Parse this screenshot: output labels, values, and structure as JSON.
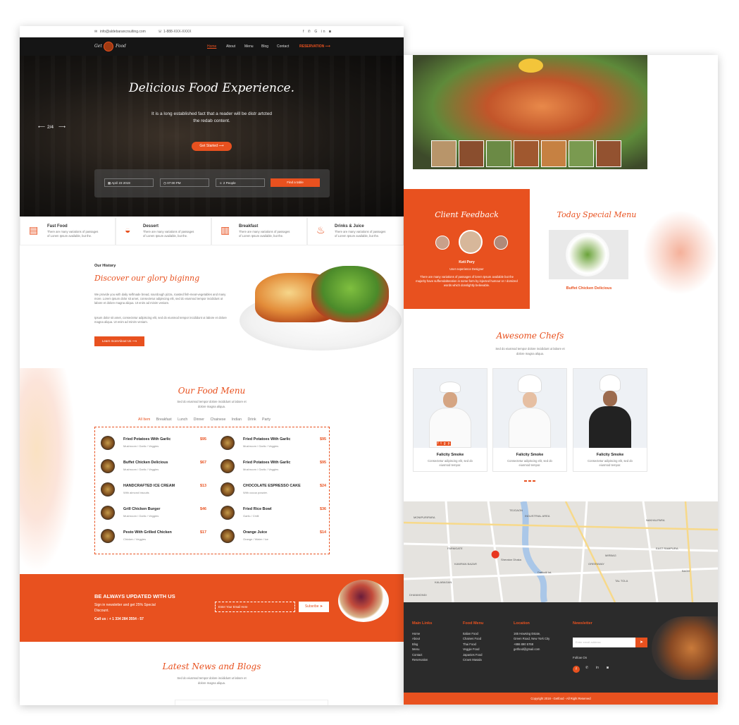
{
  "top": {
    "email": "info@aldebarancrsulting.com",
    "phone": "1-888-XXX-XXXX",
    "social_icons": [
      "facebook-icon",
      "twitter-icon",
      "google-icon",
      "linkedin-icon",
      "instagram-icon"
    ]
  },
  "brand": {
    "logo_left": "Get",
    "logo_right": "Food"
  },
  "nav": {
    "items": [
      "Home",
      "About",
      "Menu",
      "Blog",
      "Contact"
    ],
    "reservation": "RESERVATION",
    "active": "Home"
  },
  "hero": {
    "title": "Delicious Food Experience.",
    "subtitle_line1": "It is a long established fact that a reader will be distr artcted",
    "subtitle_line2": "the redab content.",
    "slide": "2/4",
    "cta": "Get Started"
  },
  "booking": {
    "date": "April 23 2019",
    "time": "07:00 PM",
    "people": "2 People",
    "button": "Find a table"
  },
  "features": [
    {
      "title": "Fast Food",
      "desc1": "There are many variations of passages",
      "desc2": "of Lorem Ipsum available, but the."
    },
    {
      "title": "Dessert",
      "desc1": "There are many variations of passages",
      "desc2": "of Lorem Ipsum available, but the."
    },
    {
      "title": "Breakfast",
      "desc1": "There are many variations of passages",
      "desc2": "of Lorem Ipsum available, but the."
    },
    {
      "title": "Drinks & Juice",
      "desc1": "There are many variations of passages",
      "desc2": "of Lorem Ipsum available, but the."
    }
  ],
  "history": {
    "label": "Our History",
    "title": "Discover our glory biginng",
    "para1": "We provide you with daily selfmade bread, sourdough pizza, roasted fish-meat-vegetables and many more. Lorem ipsum dolor sit amet, consectetur adipiscing elit, sed do eiusmod tempor incididunt ut labore et dolore magna aliqua. Ut enim ad minim veniam.",
    "para2": "Ipsum dolor sit amet, consectetur adipiscing elit, sed do eiusmod tempor incididunt ut labore et dolore magna aliqua. Ut enim ad minim veniam.",
    "button": "Learn moreAbout Us"
  },
  "food_menu": {
    "title": "Our Food Menu",
    "subtitle1": "Sed do eiusmod tempor dolore incididunt ut labore et",
    "subtitle2": "dolore magna aliqua.",
    "tabs": [
      "All Item",
      "Breakfast",
      "Lunch",
      "Dinner",
      "Chainese",
      "Indian",
      "Drink",
      "Party"
    ],
    "items": [
      {
        "name": "Fried Potatoes With Garlic",
        "price": "$95",
        "desc": "Mushroom / Garlic / Veggies"
      },
      {
        "name": "Fried Potatoes With Garlic",
        "price": "$95",
        "desc": "Mushroom / Garlic / Veggies"
      },
      {
        "name": "Buffet Chicken Delicious",
        "price": "$67",
        "desc": "Mushroom / Garlic / Veggies"
      },
      {
        "name": "Fried Potatoes With Garlic",
        "price": "$95",
        "desc": "Mushroom / Garlic / Veggies"
      },
      {
        "name": "HANDCRAFTED ICE CREAM",
        "price": "$13",
        "desc": "With almond biscuits"
      },
      {
        "name": "CHOCOLATE ESPRESSO CAKE",
        "price": "$24",
        "desc": "With cocoa powder."
      },
      {
        "name": "Grill Chicken Burger",
        "price": "$46",
        "desc": "Mushroom / Garlic / Veggies"
      },
      {
        "name": "Fried Rice Bowl",
        "price": "$36",
        "desc": "Garlic / Chilli"
      },
      {
        "name": "Pesto With Grilled Chicken",
        "price": "$17",
        "desc": "Chicken / Veggies"
      },
      {
        "name": "Orange Juice",
        "price": "$14",
        "desc": "Orange / Water / Ice"
      }
    ]
  },
  "newsletter": {
    "title": "BE ALWAYS UPDATED WITH US",
    "text1": "Sign in newsletter and get 25% Special",
    "text2": "Discount.",
    "call": "Call us : + 1 334 284 3554 - 57",
    "placeholder": "Enter Your Email Here",
    "button": "Subsribe"
  },
  "blog": {
    "title": "Latest News and Blogs",
    "subtitle1": "Sed do eiusmod tempor dolore incididunt ut labore et",
    "subtitle2": "dolore magna aliqua."
  },
  "feedback": {
    "title": "Client Feedback",
    "name": "Keti Pery",
    "role": "User experience Designer",
    "quote": "There are many variations of passages of lorem Ipsum available but the majority have sufferedalteration in some form by injected humour or r domized words which donslightly believable."
  },
  "special": {
    "title": "Today Special Menu",
    "dish": "Buffet Chicken Delicious"
  },
  "chefs": {
    "title": "Awesome Chefs",
    "subtitle1": "Sed do eiusmod tempor dolore incididunt ut labore et",
    "subtitle2": "dolore magna aliqua.",
    "items": [
      {
        "name": "Falicity Smoke",
        "desc1": "Consectetur adipiscing elit, sed do",
        "desc2": "eiusmod tempor."
      },
      {
        "name": "Falicity Smoke",
        "desc1": "Consectetur adipiscing elit, sed do",
        "desc2": "eiusmod tempor."
      },
      {
        "name": "Falicity Smoke",
        "desc1": "Consectetur adipiscing elit, sed do",
        "desc2": "eiusmod tempor."
      }
    ]
  },
  "map": {
    "labels": [
      "MONIPURIPARA",
      "TEJGAON",
      "INDUSTRIAL AREA",
      "NAKHALPARA",
      "EAST RAMPURA",
      "FARMGATE",
      "KAWRAN BAZAR",
      "GREENWAY",
      "KALABAGAN",
      "DHANMONDI",
      "TAL TOLA",
      "BAGH",
      "MIRBAG",
      "Sheraton Dhaka",
      "Daffodil Int."
    ]
  },
  "footer": {
    "main_links_title": "Main Links",
    "main_links": [
      "Home",
      "About",
      "Blog",
      "Menu",
      "Contact",
      "Reservation"
    ],
    "food_menu_title": "Food Menu",
    "food_menu": [
      "Italian Food",
      "Chaines Food",
      "Thai Food",
      "Veggie Food",
      "Japanies Food",
      "Crown Masala"
    ],
    "location_title": "Location",
    "location": [
      "165 Howsing Estate,",
      "Green Road, New York City",
      "+886 890 5768",
      "getfood@gmail.com"
    ],
    "newsletter_title": "Newsletter",
    "email_placeholder": "Enter email address",
    "follow": "Follow On",
    "copyright": "Copyright 2018 - Getfood - All Right Reserved"
  },
  "colors": {
    "accent": "#e8511f",
    "dark": "#151515",
    "footer": "#2b2b2b"
  }
}
